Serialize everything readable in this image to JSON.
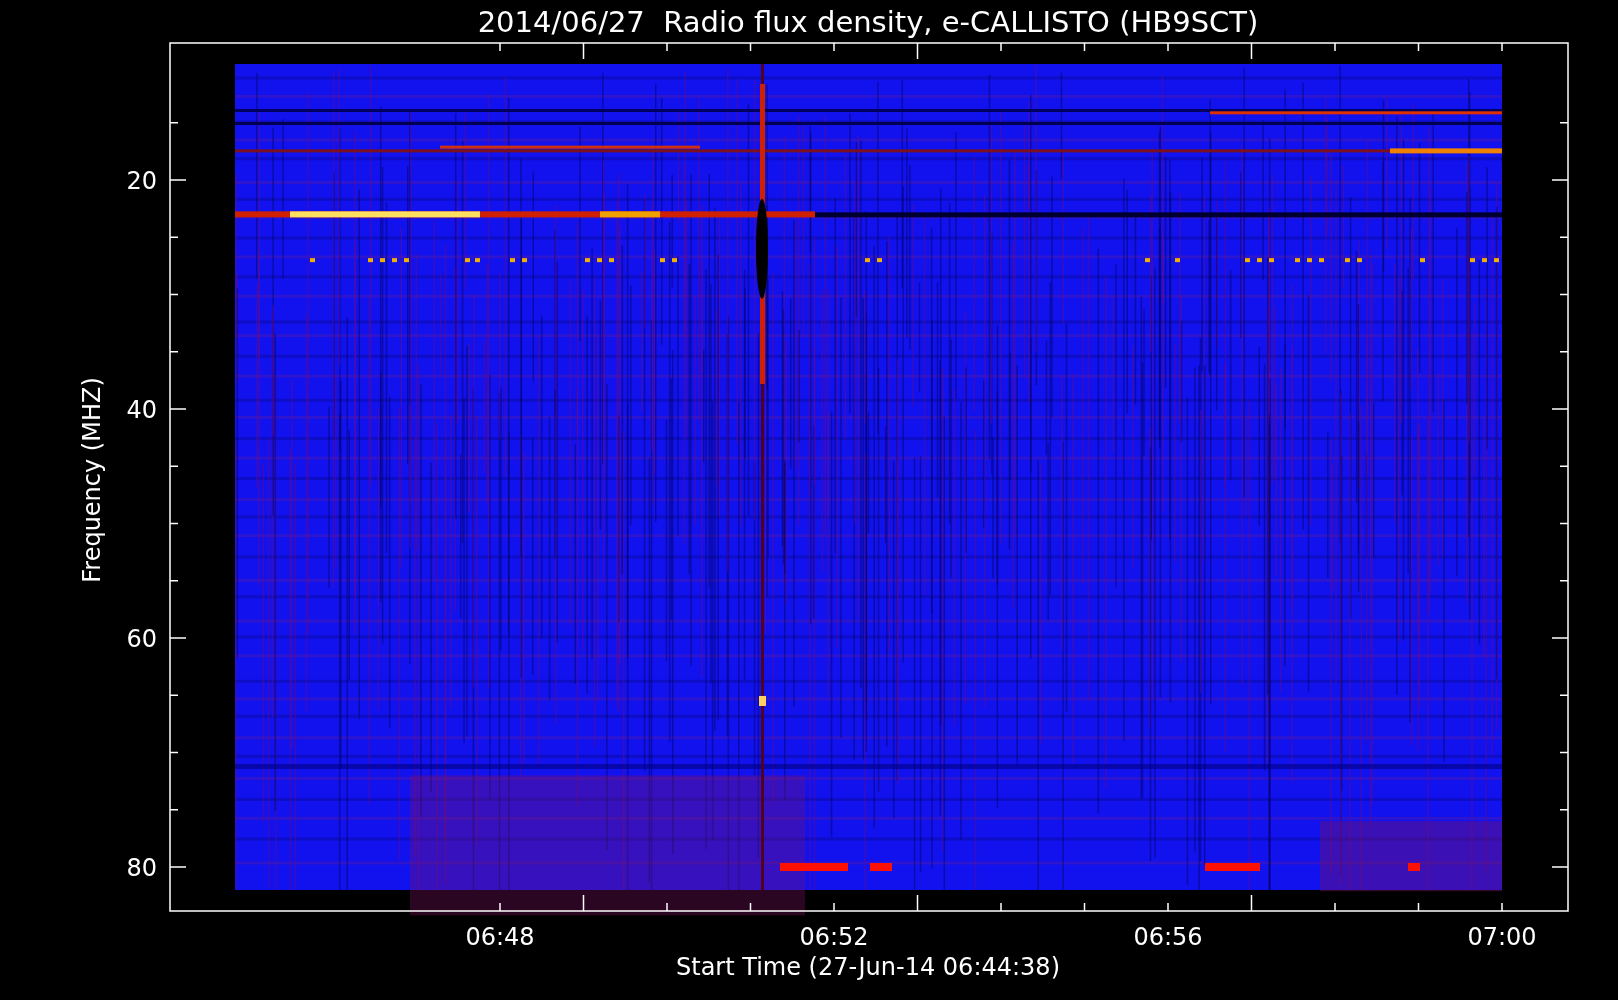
{
  "title": "2014/06/27  Radio flux density, e-CALLISTO (HB9SCT)",
  "y_axis": {
    "label": "Frequency (MHZ)",
    "ticks": [
      "20",
      "40",
      "60",
      "80"
    ]
  },
  "x_axis": {
    "label": "Start Time (27-Jun-14 06:44:38)",
    "ticks": [
      "06:48",
      "06:52",
      "06:56",
      "07:00"
    ]
  }
}
